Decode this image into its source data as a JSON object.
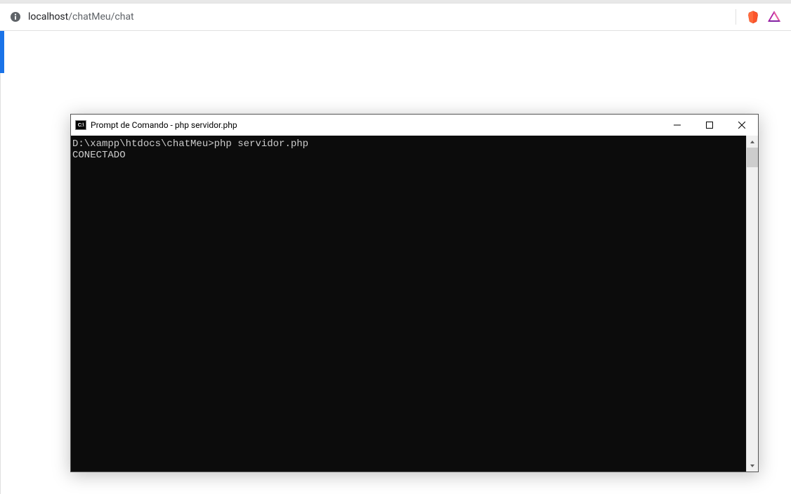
{
  "browser": {
    "url_host": "localhost",
    "url_path": "/chatMeu/chat"
  },
  "cmd": {
    "icon_text": "C:\\",
    "title": "Prompt de Comando - php  servidor.php",
    "lines": [
      "D:\\xampp\\htdocs\\chatMeu>php servidor.php",
      "CONECTADO"
    ]
  }
}
